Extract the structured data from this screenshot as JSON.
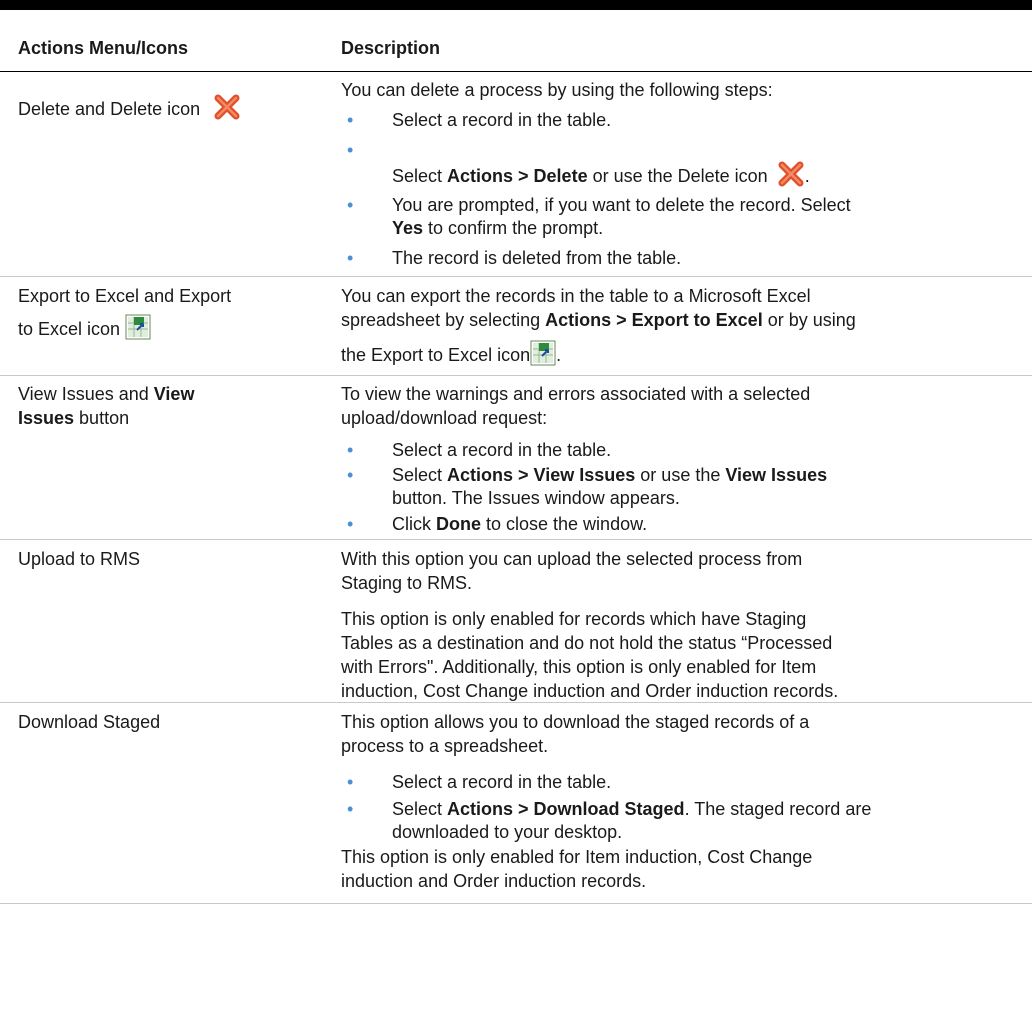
{
  "header": {
    "col1": "Actions Menu/Icons",
    "col2": "Description"
  },
  "rows": {
    "delete": {
      "label": "Delete and Delete icon",
      "icon": "delete-x-icon",
      "intro": "You can delete a process by using the following steps:",
      "b1": "Select a record in the table.",
      "b2_pre": "Select ",
      "b2_bold": "Actions > Delete",
      "b2_post": " or use the Delete icon",
      "b2_end": ".",
      "b3_line1": "You are prompted, if you want to delete the record. Select",
      "b3_bold": "Yes",
      "b3_line2": " to confirm the prompt.",
      "b4": "The record is deleted from the table."
    },
    "export": {
      "label_line1": "Export to Excel and Export",
      "label_line2": "to Excel icon",
      "icon": "export-excel-icon",
      "line1": "You can export the records in the table to a Microsoft Excel",
      "line2_pre": "spreadsheet by selecting ",
      "line2_bold": "Actions > Export to Excel",
      "line2_post": " or by using",
      "line3_pre": "the Export to Excel icon",
      "line3_end": "."
    },
    "issues": {
      "label_pre": "View Issues and ",
      "label_bold1": "View",
      "label_bold2": "Issues",
      "label_post": " button",
      "line1": "To view the warnings and errors associated with a selected",
      "line2": "upload/download request:",
      "b1": "Select a record in the table.",
      "b2_pre": "Select ",
      "b2_bold": "Actions > View Issues",
      "b2_mid": " or use the ",
      "b2_bold2": "View Issues",
      "b2_line2": "button. The Issues window appears.",
      "b3_pre": "Click ",
      "b3_bold": "Done",
      "b3_post": " to close the window."
    },
    "upload": {
      "label": "Upload to RMS",
      "p1_line1": "With this option you can upload the selected process from",
      "p1_line2": "Staging to RMS.",
      "p2_line1": "This option is only enabled for records which have Staging",
      "p2_line2": "Tables as a destination and do not hold the status “Processed",
      "p2_line3": "with Errors\". Additionally, this option is only enabled for Item",
      "p2_line4": "induction, Cost Change induction and Order induction records."
    },
    "download": {
      "label": "Download Staged",
      "p1_line1": "This option allows you to download the staged records of a",
      "p1_line2": "process to a spreadsheet.",
      "b1": "Select a record in the table.",
      "b2_pre": "Select ",
      "b2_bold": "Actions > Download Staged",
      "b2_post": ". The staged record are",
      "b2_line2": "downloaded to your desktop.",
      "p2_line1": "This option is only enabled for Item induction, Cost Change",
      "p2_line2": "induction and Order induction records."
    }
  },
  "bullet_glyph": "•",
  "colors": {
    "bullet": "#4b8fd6",
    "rule": "#c8c8c8",
    "delete_icon": "#e0502a",
    "excel_icon": "#2e8b3d"
  }
}
